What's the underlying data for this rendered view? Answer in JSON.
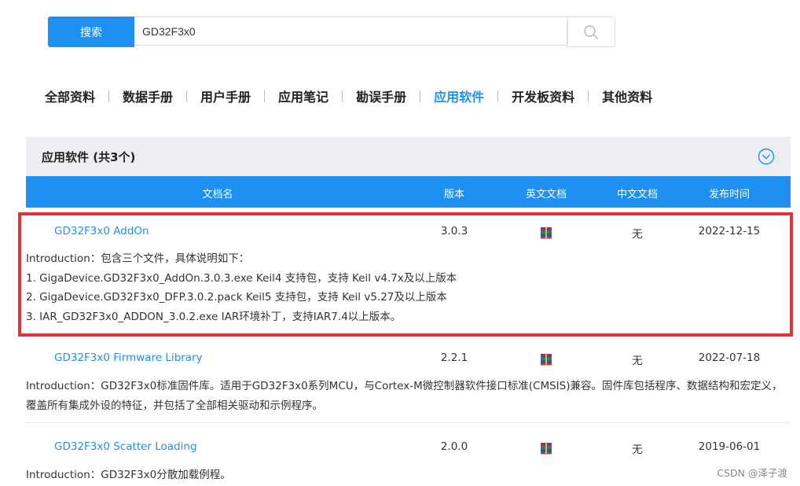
{
  "search": {
    "button_label": "搜索",
    "value": "GD32F3x0"
  },
  "tabs": [
    {
      "label": "全部资料"
    },
    {
      "label": "数据手册"
    },
    {
      "label": "用户手册"
    },
    {
      "label": "应用笔记"
    },
    {
      "label": "勘误手册"
    },
    {
      "label": "应用软件",
      "active": true
    },
    {
      "label": "开发板资料"
    },
    {
      "label": "其他资料"
    }
  ],
  "section": {
    "title": "应用软件 (共3个)"
  },
  "table": {
    "headers": {
      "name": "文档名",
      "version": "版本",
      "en_doc": "英文文档",
      "cn_doc": "中文文档",
      "date": "发布时间"
    },
    "rows": [
      {
        "name": "GD32F3x0 AddOn",
        "version": "3.0.3",
        "en_doc_icon": "winrar-archive-icon",
        "cn_doc": "无",
        "date": "2022-12-15",
        "intro": [
          "Introduction：包含三个文件，具体说明如下：",
          "1. GigaDevice.GD32F3x0_AddOn.3.0.3.exe Keil4 支持包，支持 Keil v4.7x及以上版本",
          "2. GigaDevice.GD32F3x0_DFP.3.0.2.pack Keil5 支持包，支持 Keil v5.27及以上版本",
          "3. IAR_GD32F3x0_ADDON_3.0.2.exe IAR环境补丁，支持IAR7.4以上版本。"
        ]
      },
      {
        "name": "GD32F3x0 Firmware Library",
        "version": "2.2.1",
        "en_doc_icon": "winrar-archive-icon",
        "cn_doc": "无",
        "date": "2022-07-18",
        "intro": [
          "Introduction：GD32F3x0标准固件库。适用于GD32F3x0系列MCU，与Cortex-M微控制器软件接口标准(CMSIS)兼容。固件库包括程序、数据结构和宏定义，",
          "覆盖所有集成外设的特征，并包括了全部相关驱动和示例程序。"
        ]
      },
      {
        "name": "GD32F3x0 Scatter Loading",
        "version": "2.0.0",
        "en_doc_icon": "winrar-archive-icon",
        "cn_doc": "无",
        "date": "2019-06-01",
        "intro": [
          "Introduction：GD32F3x0分散加载例程。"
        ]
      }
    ]
  },
  "watermark": "CSDN @泽子渡",
  "colors": {
    "accent": "#1e90f0",
    "highlight": "#e8303a",
    "section_bg": "#eceef1"
  }
}
